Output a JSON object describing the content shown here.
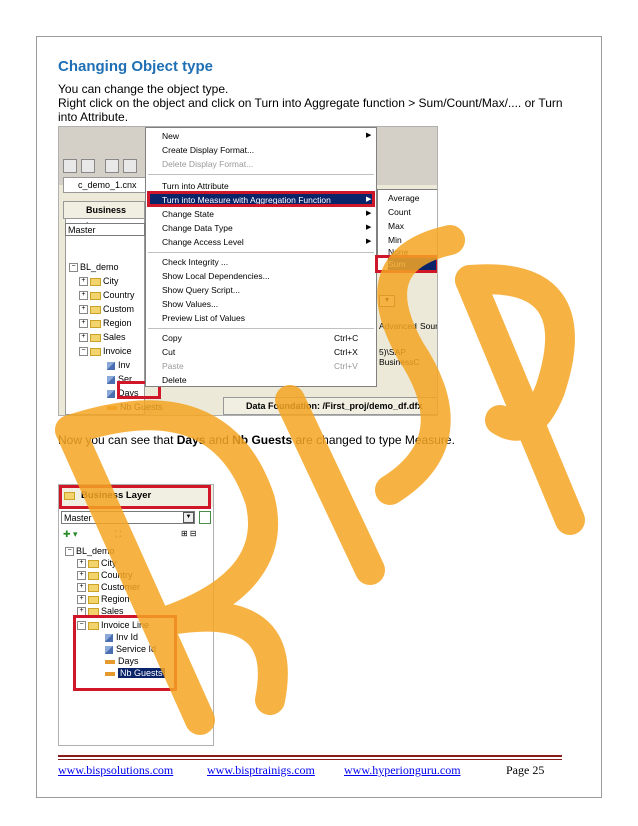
{
  "heading": "Changing Object type",
  "intro": "You can change the object type.",
  "instruction": "Right click on the object and click on Turn into Aggregate function > Sum/Count/Max/.... or Turn into Attribute.",
  "caption": {
    "pre": "Now you can see that ",
    "days": "Days",
    "and": " and ",
    "nb": "Nb Guests",
    "post": " are changed to type Measure."
  },
  "shot1": {
    "tab": "c_demo_1.cnx",
    "panel_title": "Business Lay",
    "master": "Master",
    "tree": {
      "root": "BL_demo",
      "city": "City",
      "country": "Country",
      "customer": "Custom",
      "region": "Region",
      "sales": "Sales",
      "invoice": "Invoice",
      "inv": "Inv",
      "ser": "Ser",
      "days": "Days",
      "nb": "Nb Guests"
    },
    "menu": {
      "new": "New",
      "create_format": "Create Display Format...",
      "delete_format": "Delete Display Format...",
      "attribute": "Turn into Attribute",
      "measure": "Turn into Measure with Aggregation Function",
      "state": "Change State",
      "datatype": "Change Data Type",
      "access": "Change Access Level",
      "integrity": "Check Integrity ...",
      "deps": "Show Local Dependencies...",
      "script": "Show Query Script...",
      "values": "Show Values...",
      "preview": "Preview List of Values",
      "copy": "Copy",
      "copy_sc": "Ctrl+C",
      "cut": "Cut",
      "cut_sc": "Ctrl+X",
      "paste": "Paste",
      "paste_sc": "Ctrl+V",
      "delete": "Delete"
    },
    "submenu": {
      "average": "Average",
      "count": "Count",
      "max": "Max",
      "min": "Min",
      "none": "None",
      "sum": "Sum"
    },
    "advanced": "Advanced",
    "source": "Sour",
    "path": "5)\\SAP BusinessC",
    "data_foundation": "Data Foundation: /First_proj/demo_df.dfx"
  },
  "shot2": {
    "panel_title": "Business Layer",
    "master": "Master",
    "tree": {
      "root": "BL_demo",
      "city": "City",
      "country": "Country",
      "customer": "Customer",
      "region": "Region",
      "sales": "Sales",
      "invoice": "Invoice Line",
      "inv": "Inv Id",
      "service": "Service Id",
      "days": "Days",
      "nb": "Nb Guests"
    }
  },
  "footer": {
    "link1": "www.bispsolutions.com",
    "link2": "www.bisptrainigs.com",
    "link3": "www.hyperionguru.com",
    "page": "Page 25"
  },
  "watermark": "BISP",
  "colors": {
    "heading": "#1f6fb5",
    "highlight_box": "#d0172a",
    "watermark": "#f5a623",
    "menu_selection": "#0a246a",
    "footer_rule": "#8b1a1a"
  }
}
